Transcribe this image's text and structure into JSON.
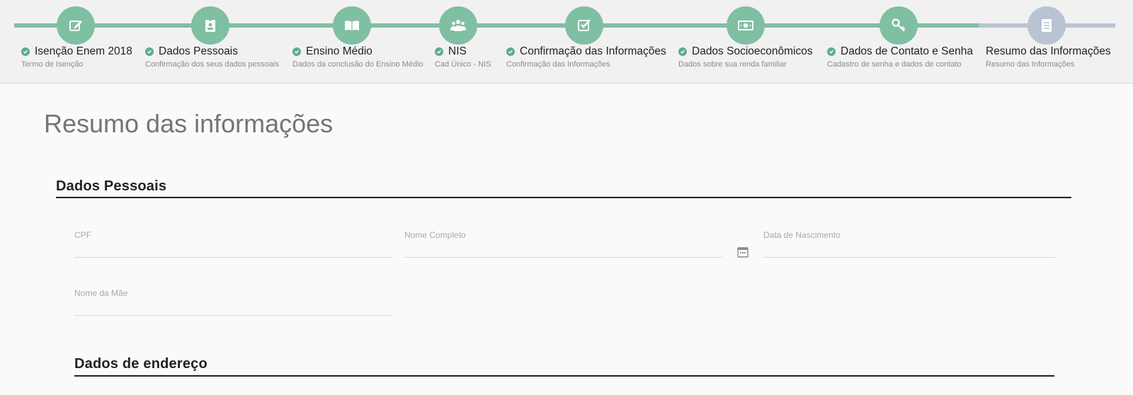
{
  "stepper": {
    "steps": [
      {
        "title": "Isenção Enem 2018",
        "subtitle": "Termo de Isenção",
        "icon": "pencil-icon",
        "done": true
      },
      {
        "title": "Dados Pessoais",
        "subtitle": "Confirmação dos seus dados pessoais",
        "icon": "id-badge-icon",
        "done": true
      },
      {
        "title": "Ensino Médio",
        "subtitle": "Dados da conclusão do Ensino Médio",
        "icon": "book-icon",
        "done": true
      },
      {
        "title": "NIS",
        "subtitle": "Cad Único - NIS",
        "icon": "users-icon",
        "done": true
      },
      {
        "title": "Confirmação das Informações",
        "subtitle": "Confirmação das Informações",
        "icon": "checkbox-icon",
        "done": true
      },
      {
        "title": "Dados Socioeconômicos",
        "subtitle": "Dados sobre sua renda familiar",
        "icon": "money-icon",
        "done": true
      },
      {
        "title": "Dados de Contato e Senha",
        "subtitle": "Cadastro de senha e dados de contato",
        "icon": "key-icon",
        "done": true
      },
      {
        "title": "Resumo das Informações",
        "subtitle": "Resumo das Informações",
        "icon": "document-icon",
        "done": false
      }
    ]
  },
  "colors": {
    "done": "#7fbfa2",
    "todo": "#b9c4d2",
    "check": "#5cae8a"
  },
  "page": {
    "title": "Resumo das informações"
  },
  "personal": {
    "heading": "Dados Pessoais",
    "cpf_label": "CPF",
    "name_label": "Nome Completo",
    "birth_label": "Data de Nascimento",
    "mother_label": "Nome da Mãe",
    "calendar_icon": "calendar-icon"
  },
  "address": {
    "heading": "Dados de endereço"
  }
}
